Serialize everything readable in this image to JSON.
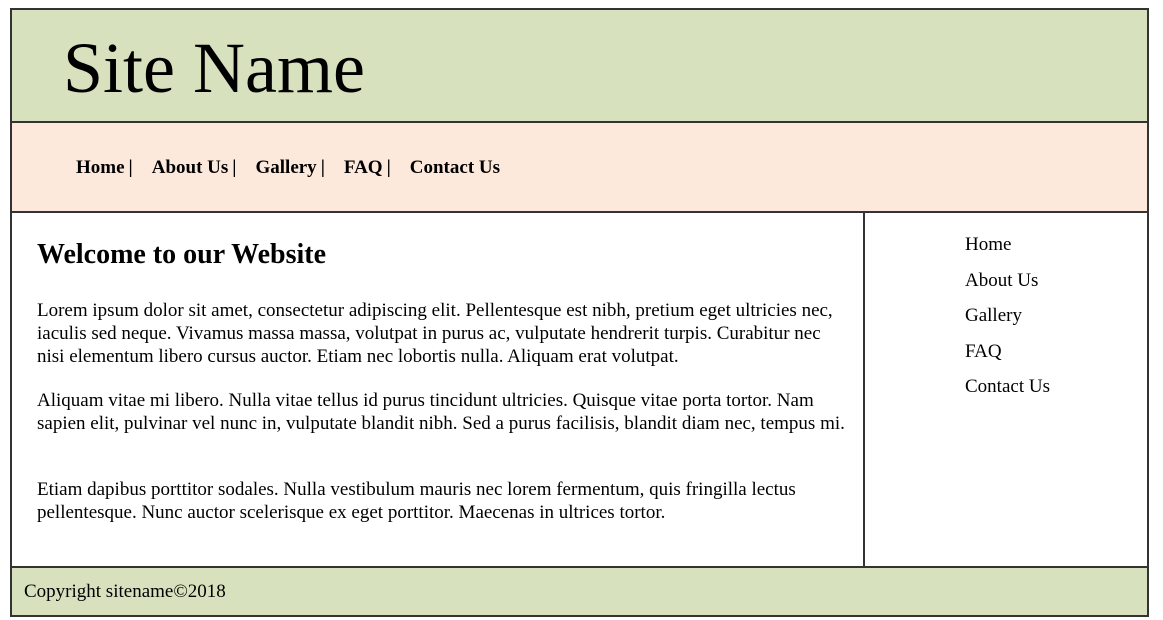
{
  "colors": {
    "header_bg": "#d7e1bd",
    "nav_bg": "#fde8dc",
    "footer_bg": "#d7e1bd",
    "border": "#333333"
  },
  "header": {
    "site_name": "Site Name"
  },
  "topnav": {
    "items": [
      {
        "label": "Home",
        "sep": "|"
      },
      {
        "label": "About Us",
        "sep": "|"
      },
      {
        "label": "Gallery",
        "sep": "|"
      },
      {
        "label": "FAQ",
        "sep": "|"
      },
      {
        "label": "Contact Us"
      }
    ]
  },
  "main": {
    "heading": "Welcome to our Website",
    "paragraphs": [
      "Lorem ipsum dolor sit amet, consectetur adipiscing elit. Pellentesque est nibh, pretium eget ultricies nec, iaculis sed neque. Vivamus massa massa, volutpat in purus ac, vulputate hendrerit turpis. Curabitur nec nisi elementum libero cursus auctor. Etiam nec lobortis nulla. Aliquam erat volutpat.",
      "Aliquam vitae mi libero. Nulla vitae tellus id purus tincidunt ultricies. Quisque vitae porta tortor. Nam sapien elit, pulvinar vel nunc in, vulputate blandit nibh. Sed a purus facilisis, blandit diam nec, tempus mi.",
      "Etiam dapibus porttitor sodales. Nulla vestibulum mauris nec lorem fermentum, quis fringilla lectus pellentesque. Nunc auctor scelerisque ex eget porttitor. Maecenas in ultrices tortor."
    ]
  },
  "sidebar": {
    "items": [
      {
        "label": "Home"
      },
      {
        "label": "About Us"
      },
      {
        "label": "Gallery"
      },
      {
        "label": "FAQ"
      },
      {
        "label": "Contact Us"
      }
    ]
  },
  "footer": {
    "copyright": "Copyright sitename©2018"
  }
}
